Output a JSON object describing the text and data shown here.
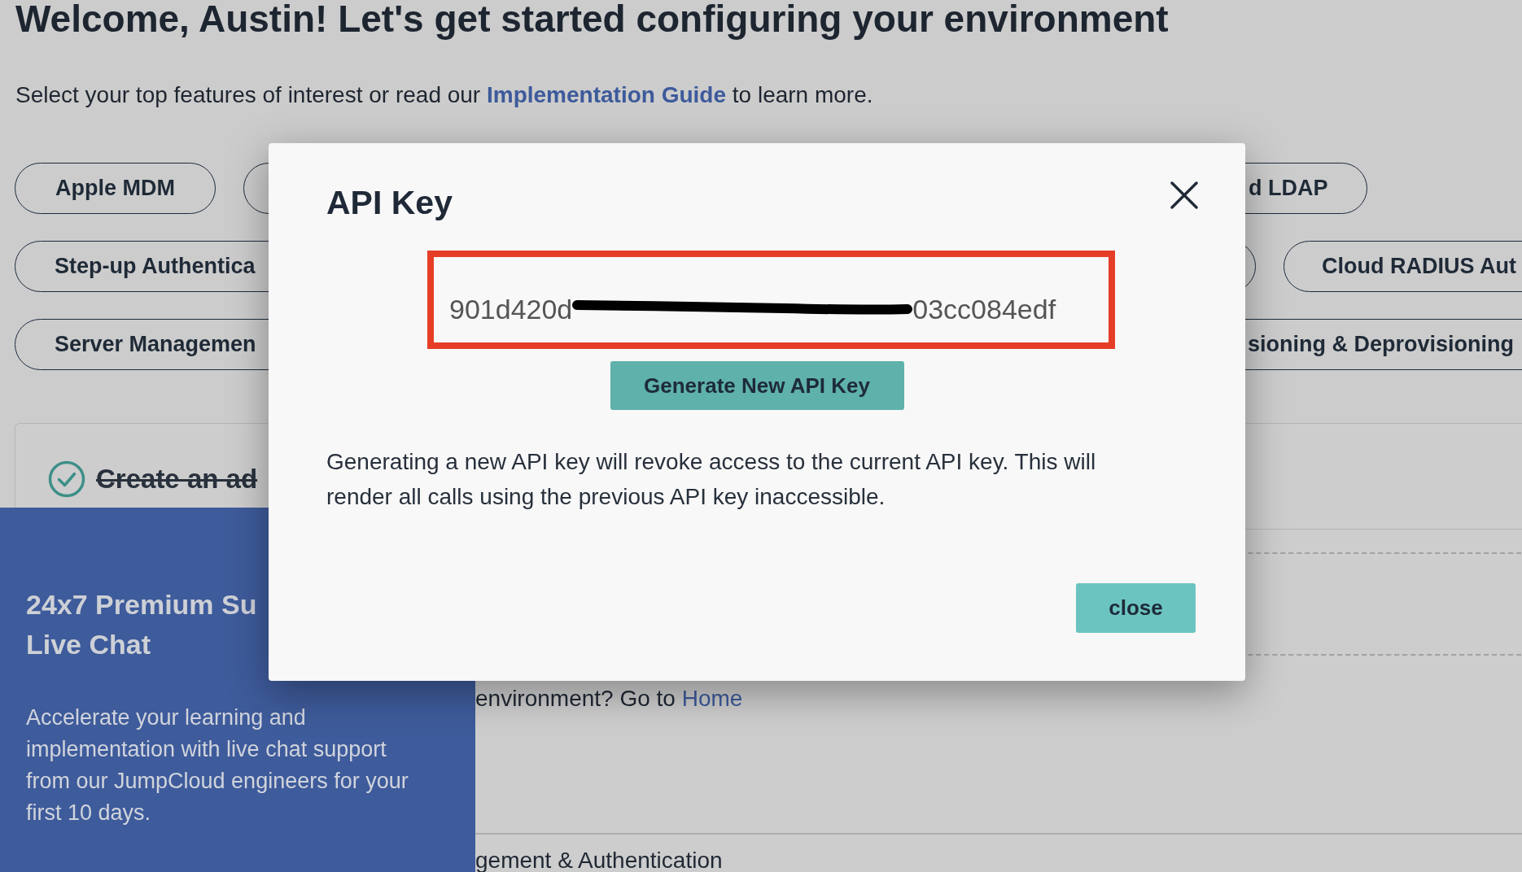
{
  "page": {
    "heading": "Welcome, Austin! Let's get started configuring your environment",
    "intro": {
      "before": "Select your top features of interest or read our ",
      "link": "Implementation Guide",
      "after": " to learn more."
    },
    "feature_rows": [
      {
        "left": [
          "Apple MDM"
        ],
        "right": [
          "d LDAP"
        ]
      },
      {
        "left": [
          "Step-up Authentica"
        ],
        "right": [
          "Cloud RADIUS Aut"
        ]
      },
      {
        "left": [
          "Server Managemen"
        ],
        "right": [
          "sioning & Deprovisioning"
        ]
      }
    ],
    "task_card": {
      "title": "Create an ad",
      "completed": true
    },
    "setup_note": {
      "text": "environment? Go to ",
      "link": "Home"
    },
    "section_title": "gement & Authentication"
  },
  "chat_promo": {
    "title_lines": [
      "24x7 Premium Su",
      "Live Chat"
    ],
    "body": "Accelerate your learning and implementation with live chat support from our JumpCloud engineers for your first 10 days."
  },
  "modal": {
    "title": "API Key",
    "api_key": {
      "start": "901d420d",
      "end": "03cc084edf",
      "redacted": true
    },
    "generate_button": "Generate New API Key",
    "warning": "Generating a new API key will revoke access to the current API key. This will render all calls using the previous API key inaccessible.",
    "close_button": "close"
  }
}
